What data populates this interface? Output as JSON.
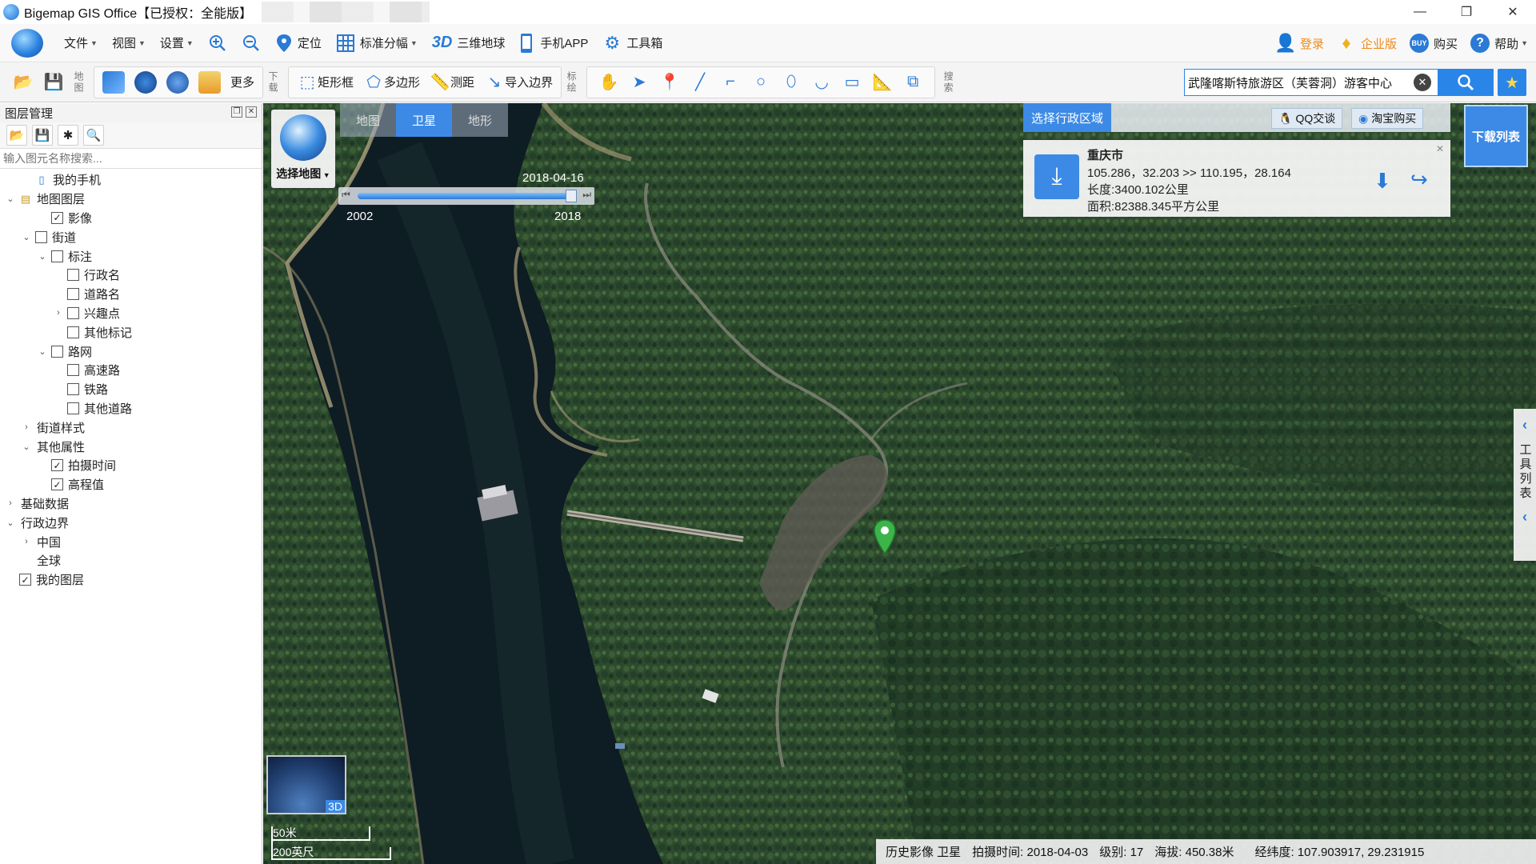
{
  "window": {
    "title": "Bigemap GIS Office【已授权：全能版】",
    "controls": [
      "—",
      "❐",
      "✕"
    ]
  },
  "menubar": {
    "items": [
      {
        "label": "文件",
        "icon": "caret-down-icon"
      },
      {
        "label": "视图",
        "icon": "caret-down-icon"
      },
      {
        "label": "设置",
        "icon": "caret-down-icon"
      }
    ],
    "zoom_in_icon": "zoom-in-icon",
    "zoom_out_icon": "zoom-out-icon",
    "locate": "定位",
    "standard_sheet": "标准分幅",
    "globe_3d_prefix": "3D",
    "globe_3d": "三维地球",
    "mobile_app": "手机APP",
    "toolbox": "工具箱",
    "login": "登录",
    "enterprise": "企业版",
    "buy": "购买",
    "help": "帮助"
  },
  "toolbar": {
    "map_label": "地图",
    "more": "更多",
    "download_label": "下载",
    "rectangle": "矩形框",
    "polygon": "多边形",
    "measure": "测距",
    "import_boundary": "导入边界",
    "mark_label": "标绘",
    "search_label": "搜索",
    "search_value": "武隆喀斯特旅游区（芙蓉洞）游客中心"
  },
  "panel": {
    "title": "图层管理",
    "search_placeholder": "输入图元名称搜索...",
    "tree": [
      {
        "label": "我的手机",
        "level": 1,
        "arrow": "",
        "checkbox": false,
        "icon": "phone"
      },
      {
        "label": "地图图层",
        "level": 0,
        "arrow": "v",
        "checkbox": false,
        "icon": "layers"
      },
      {
        "label": "影像",
        "level": 2,
        "arrow": "",
        "checkbox": true,
        "checked": true
      },
      {
        "label": "街道",
        "level": 1,
        "arrow": "v",
        "checkbox": true,
        "checked": false
      },
      {
        "label": "标注",
        "level": 2,
        "arrow": "v",
        "checkbox": true,
        "checked": false
      },
      {
        "label": "行政名",
        "level": 3,
        "arrow": "",
        "checkbox": true,
        "checked": false
      },
      {
        "label": "道路名",
        "level": 3,
        "arrow": "",
        "checkbox": true,
        "checked": false
      },
      {
        "label": "兴趣点",
        "level": 3,
        "arrow": ">",
        "checkbox": true,
        "checked": false
      },
      {
        "label": "其他标记",
        "level": 3,
        "arrow": "",
        "checkbox": true,
        "checked": false
      },
      {
        "label": "路网",
        "level": 2,
        "arrow": "v",
        "checkbox": true,
        "checked": false
      },
      {
        "label": "高速路",
        "level": 3,
        "arrow": "",
        "checkbox": true,
        "checked": false
      },
      {
        "label": "铁路",
        "level": 3,
        "arrow": "",
        "checkbox": true,
        "checked": false
      },
      {
        "label": "其他道路",
        "level": 3,
        "arrow": "",
        "checkbox": true,
        "checked": false
      },
      {
        "label": "街道样式",
        "level": 1,
        "arrow": ">",
        "checkbox": false
      },
      {
        "label": "其他属性",
        "level": 1,
        "arrow": "v",
        "checkbox": false
      },
      {
        "label": "拍摄时间",
        "level": 2,
        "arrow": "",
        "checkbox": true,
        "checked": true
      },
      {
        "label": "高程值",
        "level": 2,
        "arrow": "",
        "checkbox": true,
        "checked": true
      },
      {
        "label": "基础数据",
        "level": 0,
        "arrow": ">",
        "checkbox": false
      },
      {
        "label": "行政边界",
        "level": 0,
        "arrow": "v",
        "checkbox": false
      },
      {
        "label": "中国",
        "level": 1,
        "arrow": ">",
        "checkbox": false
      },
      {
        "label": "全球",
        "level": 1,
        "arrow": "",
        "checkbox": false
      },
      {
        "label": "我的图层",
        "level": 0,
        "arrow": "",
        "checkbox": true,
        "checked": true
      }
    ]
  },
  "map": {
    "tabs": [
      {
        "label": "地图",
        "active": false
      },
      {
        "label": "卫星",
        "active": true
      },
      {
        "label": "地形",
        "active": false
      }
    ],
    "select_map": "选择地图",
    "slider": {
      "date": "2018-04-16",
      "start": "2002",
      "end": "2018",
      "progress": 1.0
    },
    "region": {
      "title": "选择行政区域",
      "qq": "QQ交谈",
      "taobao": "淘宝购买"
    },
    "info": {
      "name": "重庆市",
      "bounds": "105.286，32.203 >> 110.195，28.164",
      "length": "长度:3400.102公里",
      "area": "面积:82388.345平方公里"
    },
    "download_list": "下载列表",
    "side_tools_label": "工具列表",
    "minimap_label": "3D",
    "scale": {
      "metric": "50米",
      "imperial": "200英尺"
    },
    "status": {
      "history": "历史影像 卫星",
      "capture": "拍摄时间: 2018-04-03",
      "level": "级别: 17",
      "altitude": "海拔: 450.38米",
      "coords": "经纬度: 107.903917, 29.231915"
    }
  },
  "colors": {
    "accent": "#3c8ae6",
    "water": "#0e1c23",
    "forest": "#2b4a2c",
    "pin": "#3cb44a"
  }
}
